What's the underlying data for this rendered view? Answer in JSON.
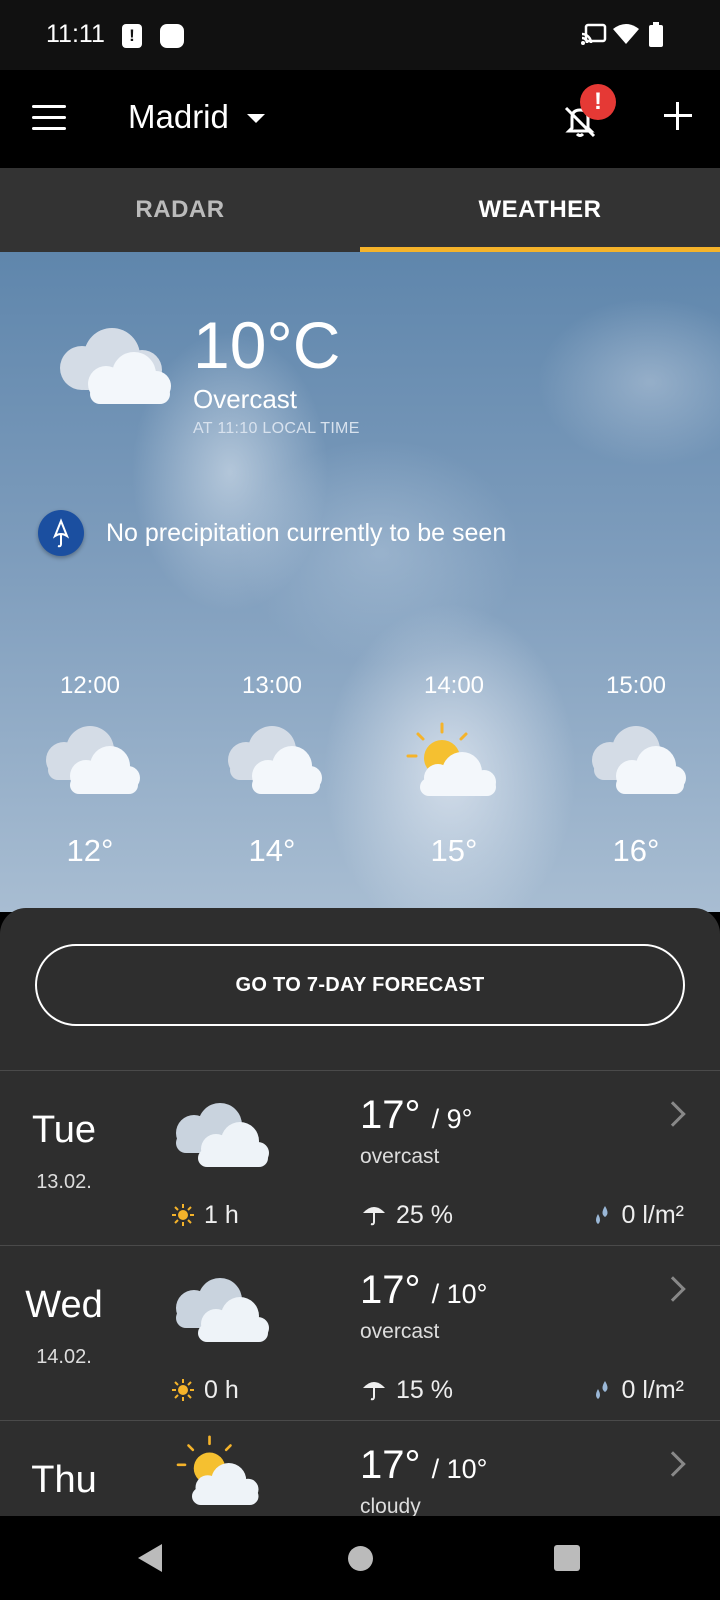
{
  "status_bar": {
    "time": "11:11",
    "icons": [
      "alert-icon",
      "notification-dot-icon",
      "cast-icon",
      "wifi-icon",
      "battery-icon"
    ]
  },
  "app_bar": {
    "city": "Madrid",
    "notification_badge": "!",
    "icons": [
      "menu-icon",
      "dropdown-caret-icon",
      "bell-off-icon",
      "add-icon"
    ]
  },
  "tabs": [
    {
      "label": "RADAR",
      "active": false
    },
    {
      "label": "WEATHER",
      "active": true
    }
  ],
  "current": {
    "temperature": "10°C",
    "condition": "Overcast",
    "local_time": "AT 11:10 LOCAL TIME",
    "precipitation_text": "No precipitation currently to be seen",
    "icon": "cloud-icon"
  },
  "hourly": [
    {
      "time": "12:00",
      "temp": "12°",
      "icon": "cloud-icon"
    },
    {
      "time": "13:00",
      "temp": "14°",
      "icon": "cloud-icon"
    },
    {
      "time": "14:00",
      "temp": "15°",
      "icon": "sun-cloud-icon"
    },
    {
      "time": "15:00",
      "temp": "16°",
      "icon": "cloud-icon"
    }
  ],
  "forecast_button": "GO TO 7-DAY FORECAST",
  "days": [
    {
      "day": "Tue",
      "date": "13.02.",
      "high": "17°",
      "low": "/ 9°",
      "condition": "overcast",
      "sun": "1 h",
      "rain_chance": "25 %",
      "rain_volume": "0 l/m²",
      "icon": "cloud-icon"
    },
    {
      "day": "Wed",
      "date": "14.02.",
      "high": "17°",
      "low": "/ 10°",
      "condition": "overcast",
      "sun": "0 h",
      "rain_chance": "15 %",
      "rain_volume": "0 l/m²",
      "icon": "cloud-icon"
    },
    {
      "day": "Thu",
      "date": "",
      "high": "17°",
      "low": "/ 10°",
      "condition": "cloudy",
      "sun": "",
      "rain_chance": "",
      "rain_volume": "",
      "icon": "sun-cloud-icon"
    }
  ],
  "colors": {
    "accent": "#f5b32a",
    "badge": "#e53935",
    "sheet": "#2e2e2e",
    "precip_icon": "#1b4fa0"
  }
}
